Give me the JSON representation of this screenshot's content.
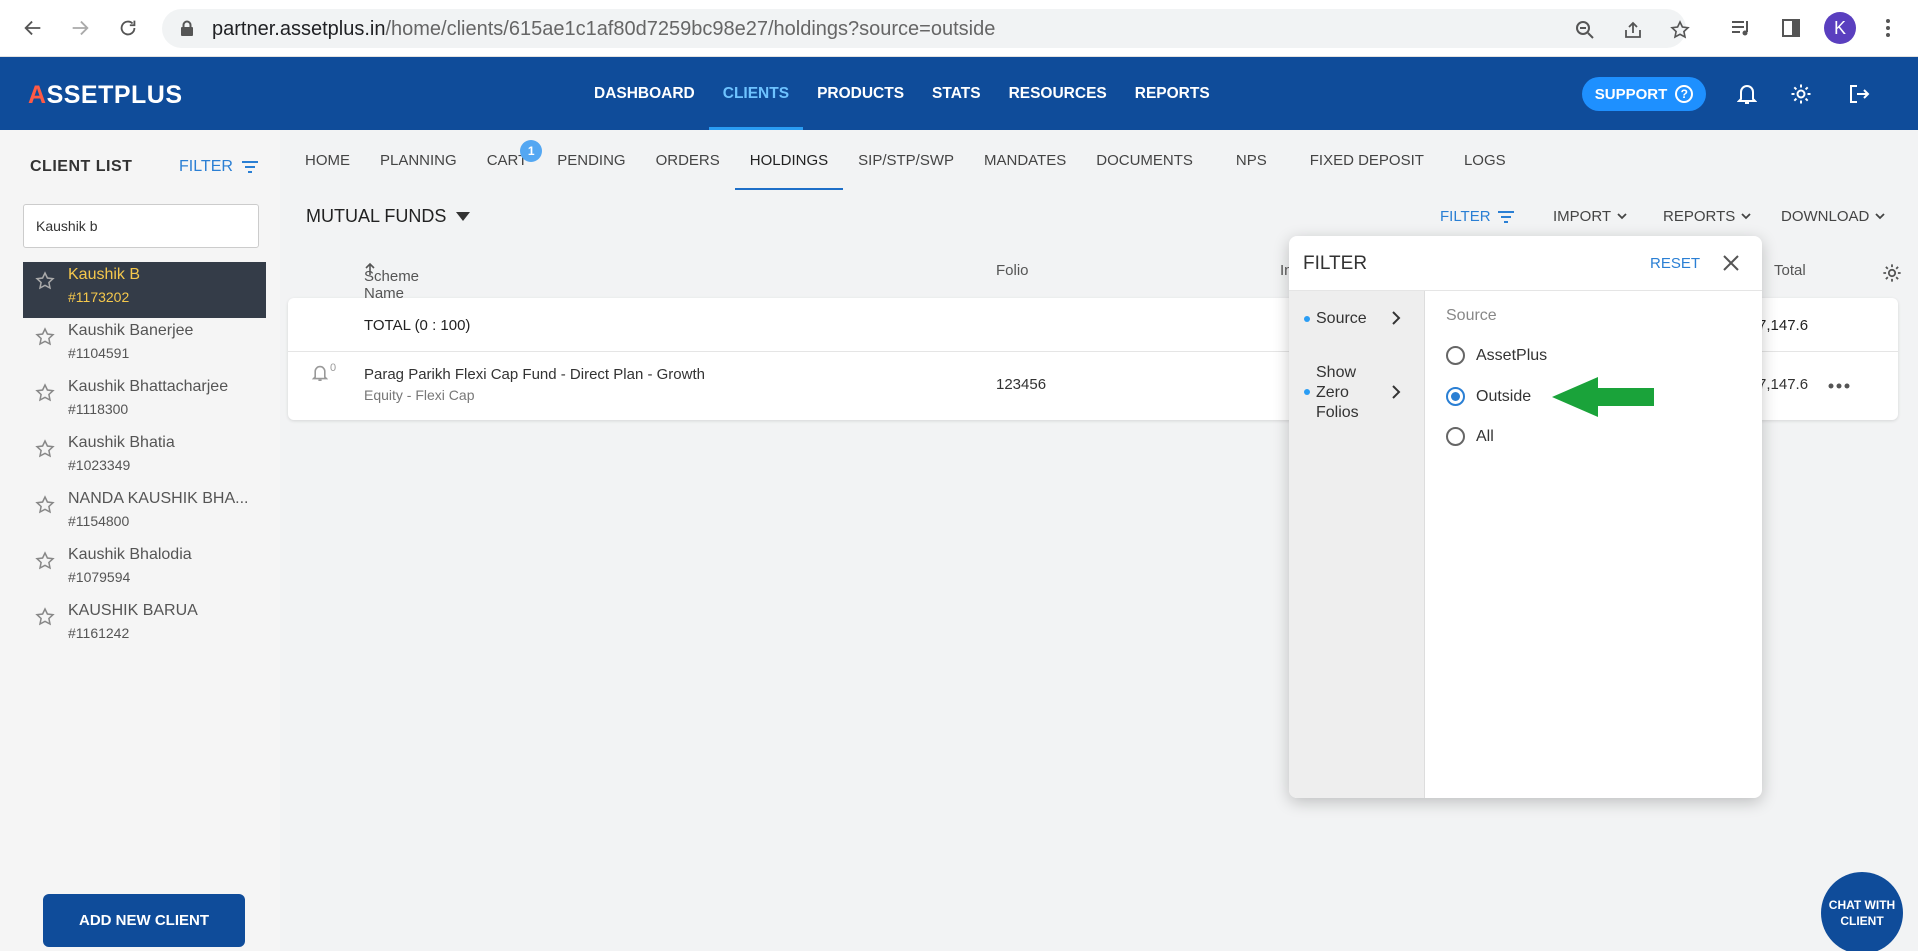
{
  "browser": {
    "url_host": "partner.assetplus.in",
    "url_path": "/home/clients/615ae1c1af80d7259bc98e27/holdings?source=outside",
    "avatar_letter": "K"
  },
  "header": {
    "logo_prefix": "A",
    "logo_text": "SSETPLUS",
    "nav": [
      "DASHBOARD",
      "CLIENTS",
      "PRODUCTS",
      "STATS",
      "RESOURCES",
      "REPORTS"
    ],
    "active_nav": "CLIENTS",
    "support_label": "SUPPORT",
    "support_icon": "?"
  },
  "sidebar": {
    "title": "CLIENT LIST",
    "filter_label": "FILTER",
    "search_value": "Kaushik b",
    "clients": [
      {
        "name": "Kaushik B",
        "id": "#1173202",
        "active": true
      },
      {
        "name": "Kaushik Banerjee",
        "id": "#1104591"
      },
      {
        "name": "Kaushik Bhattacharjee",
        "id": "#1118300"
      },
      {
        "name": "Kaushik Bhatia",
        "id": "#1023349"
      },
      {
        "name": "NANDA KAUSHIK BHA...",
        "id": "#1154800"
      },
      {
        "name": "Kaushik Bhalodia",
        "id": "#1079594"
      },
      {
        "name": "KAUSHIK BARUA",
        "id": "#1161242"
      }
    ],
    "add_client_label": "ADD NEW CLIENT"
  },
  "tabs": {
    "items": [
      "HOME",
      "PLANNING",
      "CART",
      "PENDING",
      "ORDERS",
      "HOLDINGS",
      "SIP/STP/SWP",
      "MANDATES",
      "DOCUMENTS",
      "NPS",
      "FIXED DEPOSIT",
      "LOGS"
    ],
    "active": "HOLDINGS",
    "cart_badge": "1"
  },
  "toolbar": {
    "section_title": "MUTUAL FUNDS",
    "filter_label": "FILTER",
    "import_label": "IMPORT",
    "reports_label": "REPORTS",
    "download_label": "DOWNLOAD"
  },
  "table": {
    "headers": {
      "scheme": "Scheme Name",
      "folio": "Folio",
      "inv": "In",
      "total": "Total"
    },
    "total_label": "TOTAL (0 : 100)",
    "total_value": "7,147.6",
    "row": {
      "alerts": "0",
      "scheme": "Parag Parikh Flexi Cap Fund - Direct Plan - Growth",
      "category": "Equity - Flexi Cap",
      "folio": "123456",
      "total": "7,147.6"
    }
  },
  "filter_panel": {
    "title": "FILTER",
    "reset_label": "RESET",
    "categories": [
      {
        "label": "Source"
      },
      {
        "label": "Show Zero Folios"
      }
    ],
    "section_title": "Source",
    "options": [
      "AssetPlus",
      "Outside",
      "All"
    ],
    "selected": "Outside"
  },
  "chat": {
    "label": "CHAT WITH CLIENT"
  },
  "colors": {
    "primary": "#0f4c9a",
    "accent": "#2a7fd4",
    "active_client": "#343c48",
    "arrow": "#1aa33a"
  }
}
